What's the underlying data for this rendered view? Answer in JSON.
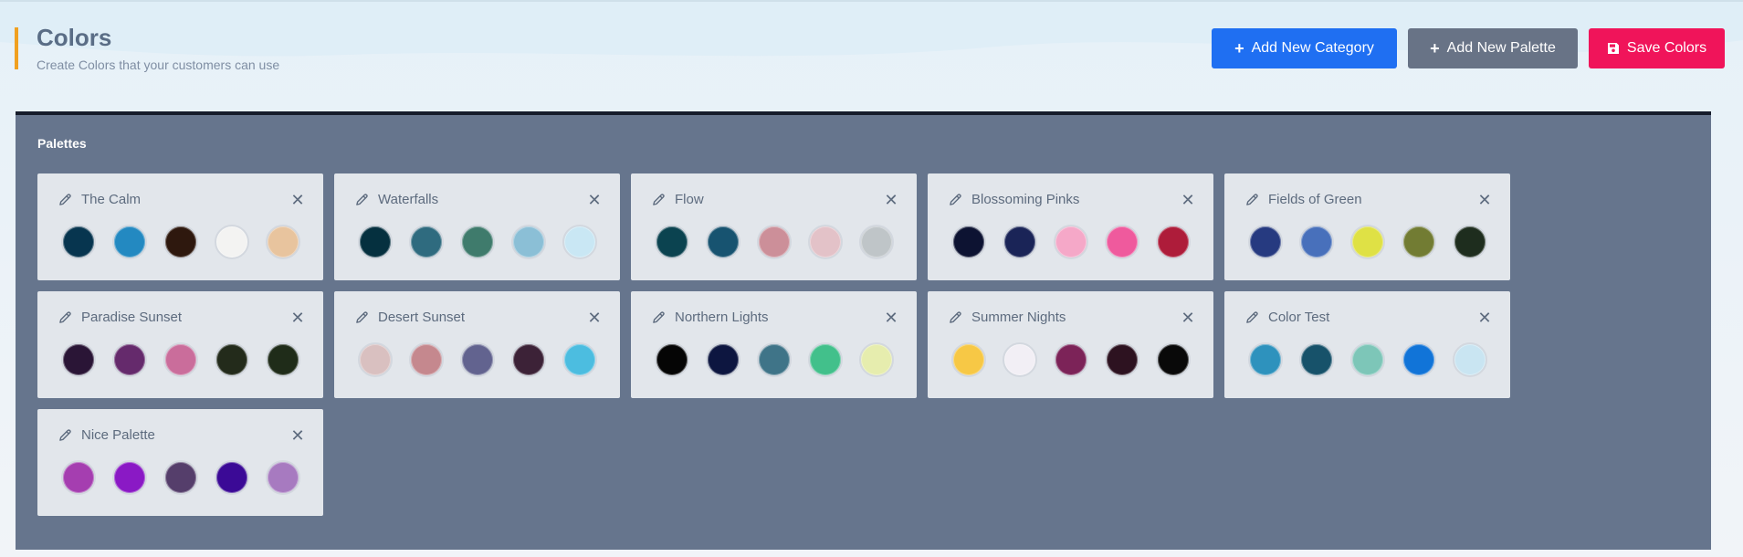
{
  "header": {
    "title": "Colors",
    "subtitle": "Create Colors that your customers can use"
  },
  "actions": {
    "add_category": {
      "label": "Add New Category",
      "icon": "plus-icon",
      "color": "#1f6ff2"
    },
    "add_palette": {
      "label": "Add New Palette",
      "icon": "plus-icon",
      "color": "#687386"
    },
    "save": {
      "label": "Save Colors",
      "icon": "save-icon",
      "color": "#f0145a"
    }
  },
  "panel": {
    "title": "Palettes",
    "palettes": [
      {
        "name": "The Calm",
        "colors": [
          "#07354f",
          "#2389c1",
          "#2e180e",
          "#f3f3f2",
          "#e8c49e"
        ]
      },
      {
        "name": "Waterfalls",
        "colors": [
          "#05303f",
          "#2f6b7f",
          "#3f7b6c",
          "#8bbfd6",
          "#c9e7f4"
        ]
      },
      {
        "name": "Flow",
        "colors": [
          "#0b4350",
          "#175370",
          "#cc8f99",
          "#e3c2c8",
          "#bfc5c8"
        ]
      },
      {
        "name": "Blossoming Pinks",
        "colors": [
          "#0d1332",
          "#1a2457",
          "#f5a8c8",
          "#ef5a9d",
          "#ae1c3a"
        ]
      },
      {
        "name": "Fields of Green",
        "colors": [
          "#263a80",
          "#4870bb",
          "#dfe145",
          "#727c33",
          "#1e2d1e"
        ]
      },
      {
        "name": "Paradise Sunset",
        "colors": [
          "#2a1536",
          "#652a6c",
          "#ca6d9b",
          "#232b1b",
          "#1f2c19"
        ]
      },
      {
        "name": "Desert Sunset",
        "colors": [
          "#d9c0c0",
          "#c5888e",
          "#62638f",
          "#3c2237",
          "#4cbde0"
        ]
      },
      {
        "name": "Northern Lights",
        "colors": [
          "#050505",
          "#0d1640",
          "#3f7488",
          "#42c08b",
          "#e6edae"
        ]
      },
      {
        "name": "Summer Nights",
        "colors": [
          "#f7c845",
          "#f2eff5",
          "#7c2358",
          "#2d1220",
          "#090909"
        ]
      },
      {
        "name": "Color Test",
        "colors": [
          "#2e92bd",
          "#17526a",
          "#7dc6b8",
          "#1174d8",
          "#c9e5f2"
        ]
      },
      {
        "name": "Nice Palette",
        "colors": [
          "#a53eb0",
          "#8a19c5",
          "#553e6b",
          "#3b0a96",
          "#a77ac0"
        ]
      }
    ]
  }
}
